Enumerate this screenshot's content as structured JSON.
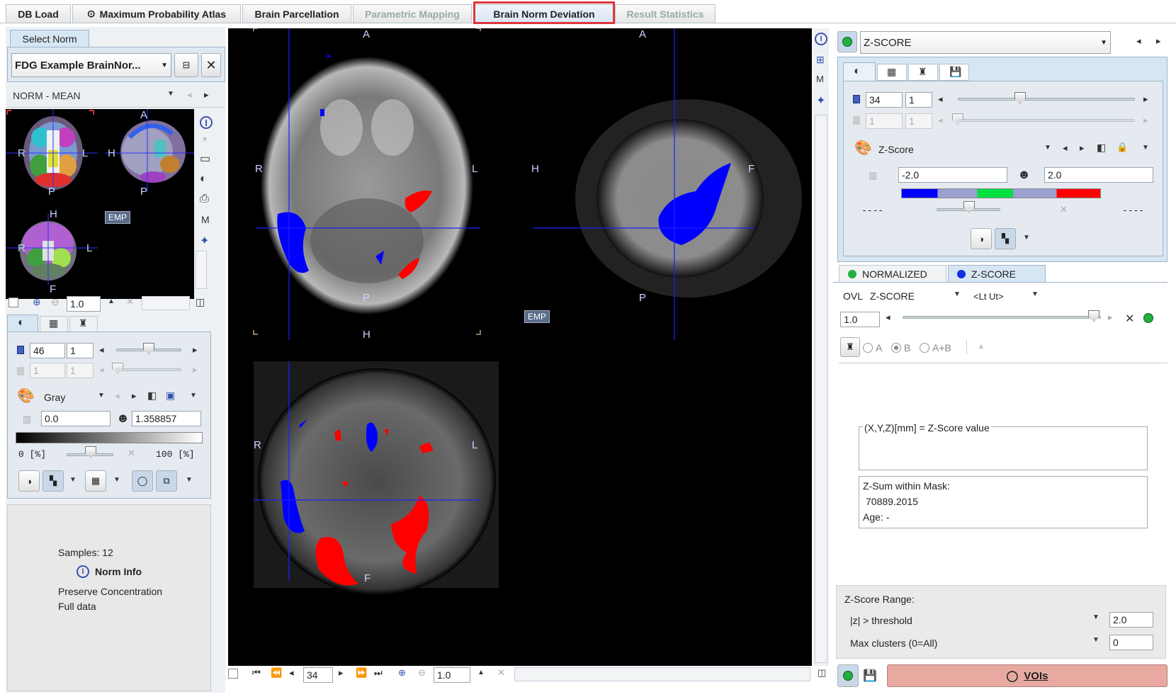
{
  "tabs": [
    {
      "label": "DB Load",
      "icon": ""
    },
    {
      "label": "Maximum Probability Atlas",
      "icon": "⊙"
    },
    {
      "label": "Brain Parcellation",
      "icon": ""
    },
    {
      "label": "Parametric Mapping",
      "icon": ""
    },
    {
      "label": "Brain Norm Deviation",
      "icon": ""
    },
    {
      "label": "Result Statistics",
      "icon": ""
    }
  ],
  "left": {
    "select_norm_tab": "Select Norm",
    "norm_name": "FDG Example BrainNor...",
    "series": "NORM - MEAN",
    "emp": "EMP",
    "zoom": "1.0",
    "slice": "46",
    "slice_step": "1",
    "dis1": "1",
    "dis2": "1",
    "colormap": "Gray",
    "min": "0.0",
    "max": "1.358857",
    "pct_min": "0 [%]",
    "pct_max": "100 [%]",
    "samples": "Samples: 12",
    "norm_info": "Norm Info",
    "preserve": "Preserve Concentration",
    "full_data": "Full data"
  },
  "center": {
    "emp": "EMP",
    "slice": "34",
    "zoom": "1.0",
    "labels": {
      "A": "A",
      "P": "P",
      "R": "R",
      "L": "L",
      "H": "H",
      "F": "F"
    }
  },
  "right": {
    "series": "Z-SCORE",
    "slice": "34",
    "slice_step": "1",
    "dis1": "1",
    "dis2": "1",
    "colormap": "Z-Score",
    "min": "-2.0",
    "max": "2.0",
    "dash_left": "----",
    "dash_right": "----",
    "tab_normalized": "NORMALIZED",
    "tab_zscore": "Z-SCORE",
    "ovl_label": "OVL",
    "ovl_series": "Z-SCORE",
    "ovl_mode": "<Lt Ut>",
    "ovl_value": "1.0",
    "radio_a": "A",
    "radio_b": "B",
    "radio_ab": "A+B",
    "coord_title": "(X,Y,Z)[mm] = Z-Score value",
    "zsum_label": "Z-Sum within Mask:",
    "zsum_value": "70889.2015",
    "age": "Age: -",
    "range_title": "Z-Score Range:",
    "threshold_label": "|z| > threshold",
    "threshold_value": "2.0",
    "clusters_label": "Max clusters (0=All)",
    "clusters_value": "0",
    "vois": "VOIs"
  },
  "colors": {
    "accent_red": "#e0353d",
    "overlay_blue": "#0000ff",
    "overlay_red": "#ff0000",
    "vois_bg": "#e8aaa0"
  }
}
